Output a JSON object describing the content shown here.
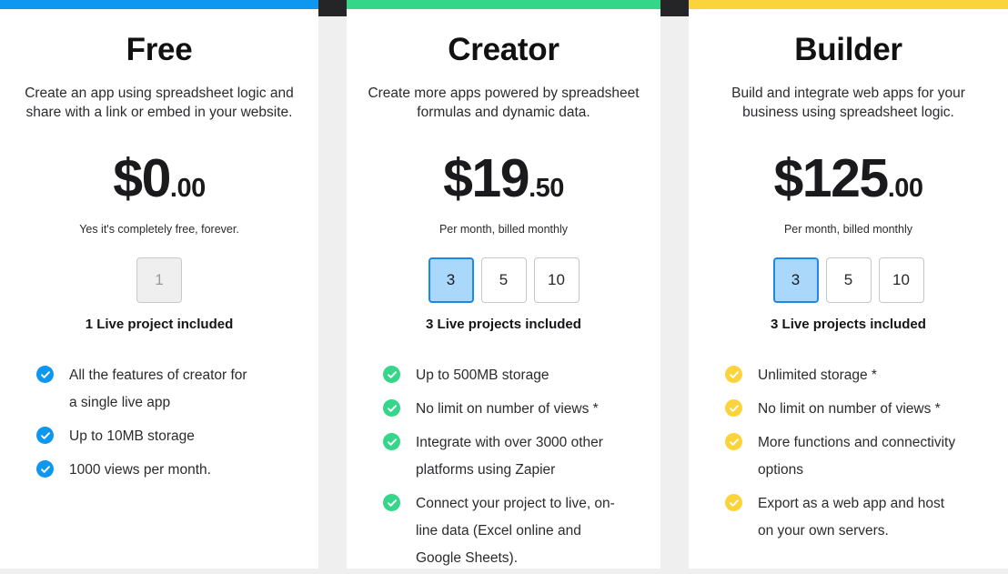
{
  "page": {
    "background_color": "#efefef",
    "top_strip_color": "#252527"
  },
  "plans": [
    {
      "name": "Free",
      "accent_color": "#0e97f0",
      "description": "Create an app using spreadsheet logic and share with a link or embed in your website.",
      "price_main": "$0",
      "price_cents": ".00",
      "price_note": "Yes it's completely free, forever.",
      "quantity_options": [
        {
          "label": "1",
          "selected": false,
          "disabled": true
        }
      ],
      "projects_note": "1 Live project included",
      "check_color": "#0e97f0",
      "features": [
        "All the features of creator for a single live app",
        "Up to 10MB storage",
        "1000 views per month."
      ]
    },
    {
      "name": "Creator",
      "accent_color": "#35d68a",
      "description": "Create more apps powered by spreadsheet formulas and dynamic data.",
      "price_main": "$19",
      "price_cents": ".50",
      "price_note": "Per month, billed monthly",
      "quantity_options": [
        {
          "label": "3",
          "selected": true,
          "disabled": false
        },
        {
          "label": "5",
          "selected": false,
          "disabled": false
        },
        {
          "label": "10",
          "selected": false,
          "disabled": false
        }
      ],
      "projects_note": "3 Live projects included",
      "check_color": "#35d68a",
      "features": [
        "Up to 500MB storage",
        "No limit on number of views *",
        "Integrate with over 3000 other platforms using Zapier",
        "Connect your project to live, on-line data (Excel online and Google Sheets)."
      ]
    },
    {
      "name": "Builder",
      "accent_color": "#fbd43c",
      "description": "Build and integrate web apps for your business using spreadsheet logic.",
      "price_main": "$125",
      "price_cents": ".00",
      "price_note": "Per month, billed monthly",
      "quantity_options": [
        {
          "label": "3",
          "selected": true,
          "disabled": false
        },
        {
          "label": "5",
          "selected": false,
          "disabled": false
        },
        {
          "label": "10",
          "selected": false,
          "disabled": false
        }
      ],
      "projects_note": "3 Live projects included",
      "check_color": "#fbd43c",
      "features": [
        "Unlimited storage *",
        "No limit on number of views *",
        "More functions and connectivity options",
        "Export as a web app and host on your own servers."
      ]
    }
  ]
}
